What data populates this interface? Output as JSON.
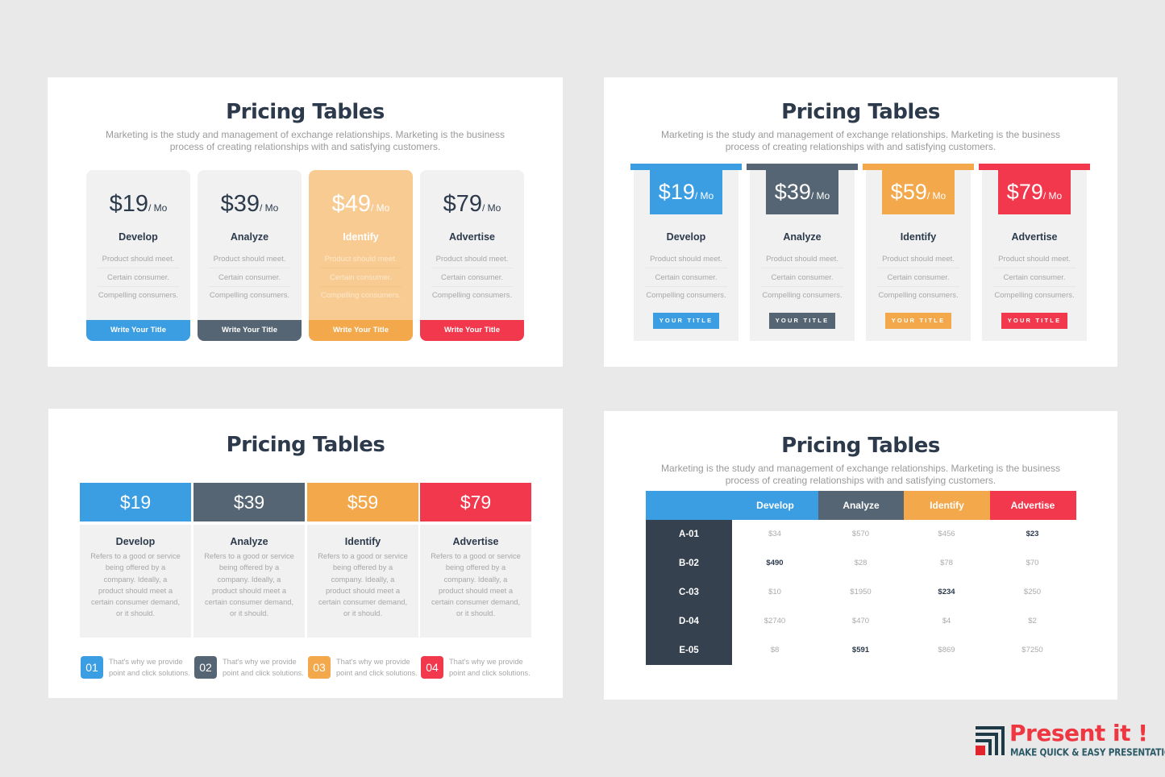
{
  "colors": {
    "blue": "#3b9ee3",
    "slate": "#566573",
    "orange": "#f2a84b",
    "red": "#f1384d",
    "navy": "#36414f",
    "background": "#e9e9e9"
  },
  "slide_title": "Pricing Tables",
  "slide_subtitle": "Marketing is the study and management of exchange relationships. Marketing is the business process of creating relationships with and satisfying customers.",
  "panel1": {
    "title": "Pricing Tables",
    "subtitle": "Marketing is the study and management of exchange relationships. Marketing is the business process of creating relationships with and satisfying customers.",
    "cards": [
      {
        "price": "$19",
        "period": "/ Mo",
        "name": "Develop",
        "features": [
          "Product should meet.",
          "Certain consumer.",
          "Compelling consumers."
        ],
        "button": "Write Your Title",
        "color": "#3b9ee3",
        "highlighted": false
      },
      {
        "price": "$39",
        "period": "/ Mo",
        "name": "Analyze",
        "features": [
          "Product should meet.",
          "Certain consumer.",
          "Compelling consumers."
        ],
        "button": "Write Your Title",
        "color": "#566573",
        "highlighted": false
      },
      {
        "price": "$49",
        "period": "/ Mo",
        "name": "Identify",
        "features": [
          "Product should meet.",
          "Certain consumer.",
          "Compelling consumers."
        ],
        "button": "Write Your Title",
        "color": "#f2a84b",
        "highlighted": true
      },
      {
        "price": "$79",
        "period": "/ Mo",
        "name": "Advertise",
        "features": [
          "Product should meet.",
          "Certain consumer.",
          "Compelling consumers."
        ],
        "button": "Write Your Title",
        "color": "#f1384d",
        "highlighted": false
      }
    ]
  },
  "panel2": {
    "title": "Pricing Tables",
    "subtitle": "Marketing is the study and management of exchange relationships. Marketing is the business process of creating relationships with and satisfying customers.",
    "cards": [
      {
        "price": "$19",
        "period": "/ Mo",
        "name": "Develop",
        "features": [
          "Product should meet.",
          "Certain consumer.",
          "Compelling consumers."
        ],
        "button": "YOUR TITLE",
        "color": "#3b9ee3"
      },
      {
        "price": "$39",
        "period": "/ Mo",
        "name": "Analyze",
        "features": [
          "Product should meet.",
          "Certain consumer.",
          "Compelling consumers."
        ],
        "button": "YOUR TITLE",
        "color": "#566573"
      },
      {
        "price": "$59",
        "period": "/ Mo",
        "name": "Identify",
        "features": [
          "Product should meet.",
          "Certain consumer.",
          "Compelling consumers."
        ],
        "button": "YOUR TITLE",
        "color": "#f2a84b"
      },
      {
        "price": "$79",
        "period": "/ Mo",
        "name": "Advertise",
        "features": [
          "Product should meet.",
          "Certain consumer.",
          "Compelling consumers."
        ],
        "button": "YOUR TITLE",
        "color": "#f1384d"
      }
    ]
  },
  "panel3": {
    "title": "Pricing Tables",
    "cards": [
      {
        "price": "$19",
        "name": "Develop",
        "description": "Refers to a good or service being offered by a company. Ideally, a product should meet a certain consumer demand, or it should.",
        "color": "#3b9ee3"
      },
      {
        "price": "$39",
        "name": "Analyze",
        "description": "Refers to a good or service being offered by a company. Ideally, a product should meet a certain consumer demand, or it should.",
        "color": "#566573"
      },
      {
        "price": "$59",
        "name": "Identify",
        "description": "Refers to a good or service being offered by a company. Ideally, a product should meet a certain consumer demand, or it should.",
        "color": "#f2a84b"
      },
      {
        "price": "$79",
        "name": "Advertise",
        "description": "Refers to a good or service being offered by a company. Ideally, a product should meet a certain consumer demand, or it should.",
        "color": "#f1384d"
      }
    ],
    "steps": [
      {
        "number": "01",
        "line1": "That's why we provide",
        "line2": "point and click solutions.",
        "color": "#3b9ee3"
      },
      {
        "number": "02",
        "line1": "That's why we provide",
        "line2": "point and click solutions.",
        "color": "#566573"
      },
      {
        "number": "03",
        "line1": "That's why we provide",
        "line2": "point and click solutions.",
        "color": "#f2a84b"
      },
      {
        "number": "04",
        "line1": "That's why we provide",
        "line2": "point and click solutions.",
        "color": "#f1384d"
      }
    ]
  },
  "panel4": {
    "title": "Pricing Tables",
    "subtitle": "Marketing is the study and management of exchange relationships. Marketing is the business process of creating relationships with and satisfying customers.",
    "columns": [
      {
        "label": "Develop",
        "color": "#3b9ee3"
      },
      {
        "label": "Analyze",
        "color": "#566573"
      },
      {
        "label": "Identify",
        "color": "#f2a84b"
      },
      {
        "label": "Advertise",
        "color": "#f1384d"
      }
    ],
    "rows": [
      {
        "label": "A-01",
        "values": [
          "$34",
          "$570",
          "$456",
          "$23"
        ],
        "bold": [
          false,
          false,
          false,
          true
        ]
      },
      {
        "label": "B-02",
        "values": [
          "$490",
          "$28",
          "$78",
          "$70"
        ],
        "bold": [
          true,
          false,
          false,
          false
        ]
      },
      {
        "label": "C-03",
        "values": [
          "$10",
          "$1950",
          "$234",
          "$250"
        ],
        "bold": [
          false,
          false,
          true,
          false
        ]
      },
      {
        "label": "D-04",
        "values": [
          "$2740",
          "$470",
          "$4",
          "$2"
        ],
        "bold": [
          false,
          false,
          false,
          false
        ]
      },
      {
        "label": "E-05",
        "values": [
          "$8",
          "$591",
          "$869",
          "$7250"
        ],
        "bold": [
          false,
          true,
          false,
          false
        ]
      }
    ]
  },
  "logo": {
    "brand": "Present it !",
    "tagline": "MAKE QUICK & EASY PRESENTATIONS",
    "icon": "present-it-logo-icon"
  }
}
